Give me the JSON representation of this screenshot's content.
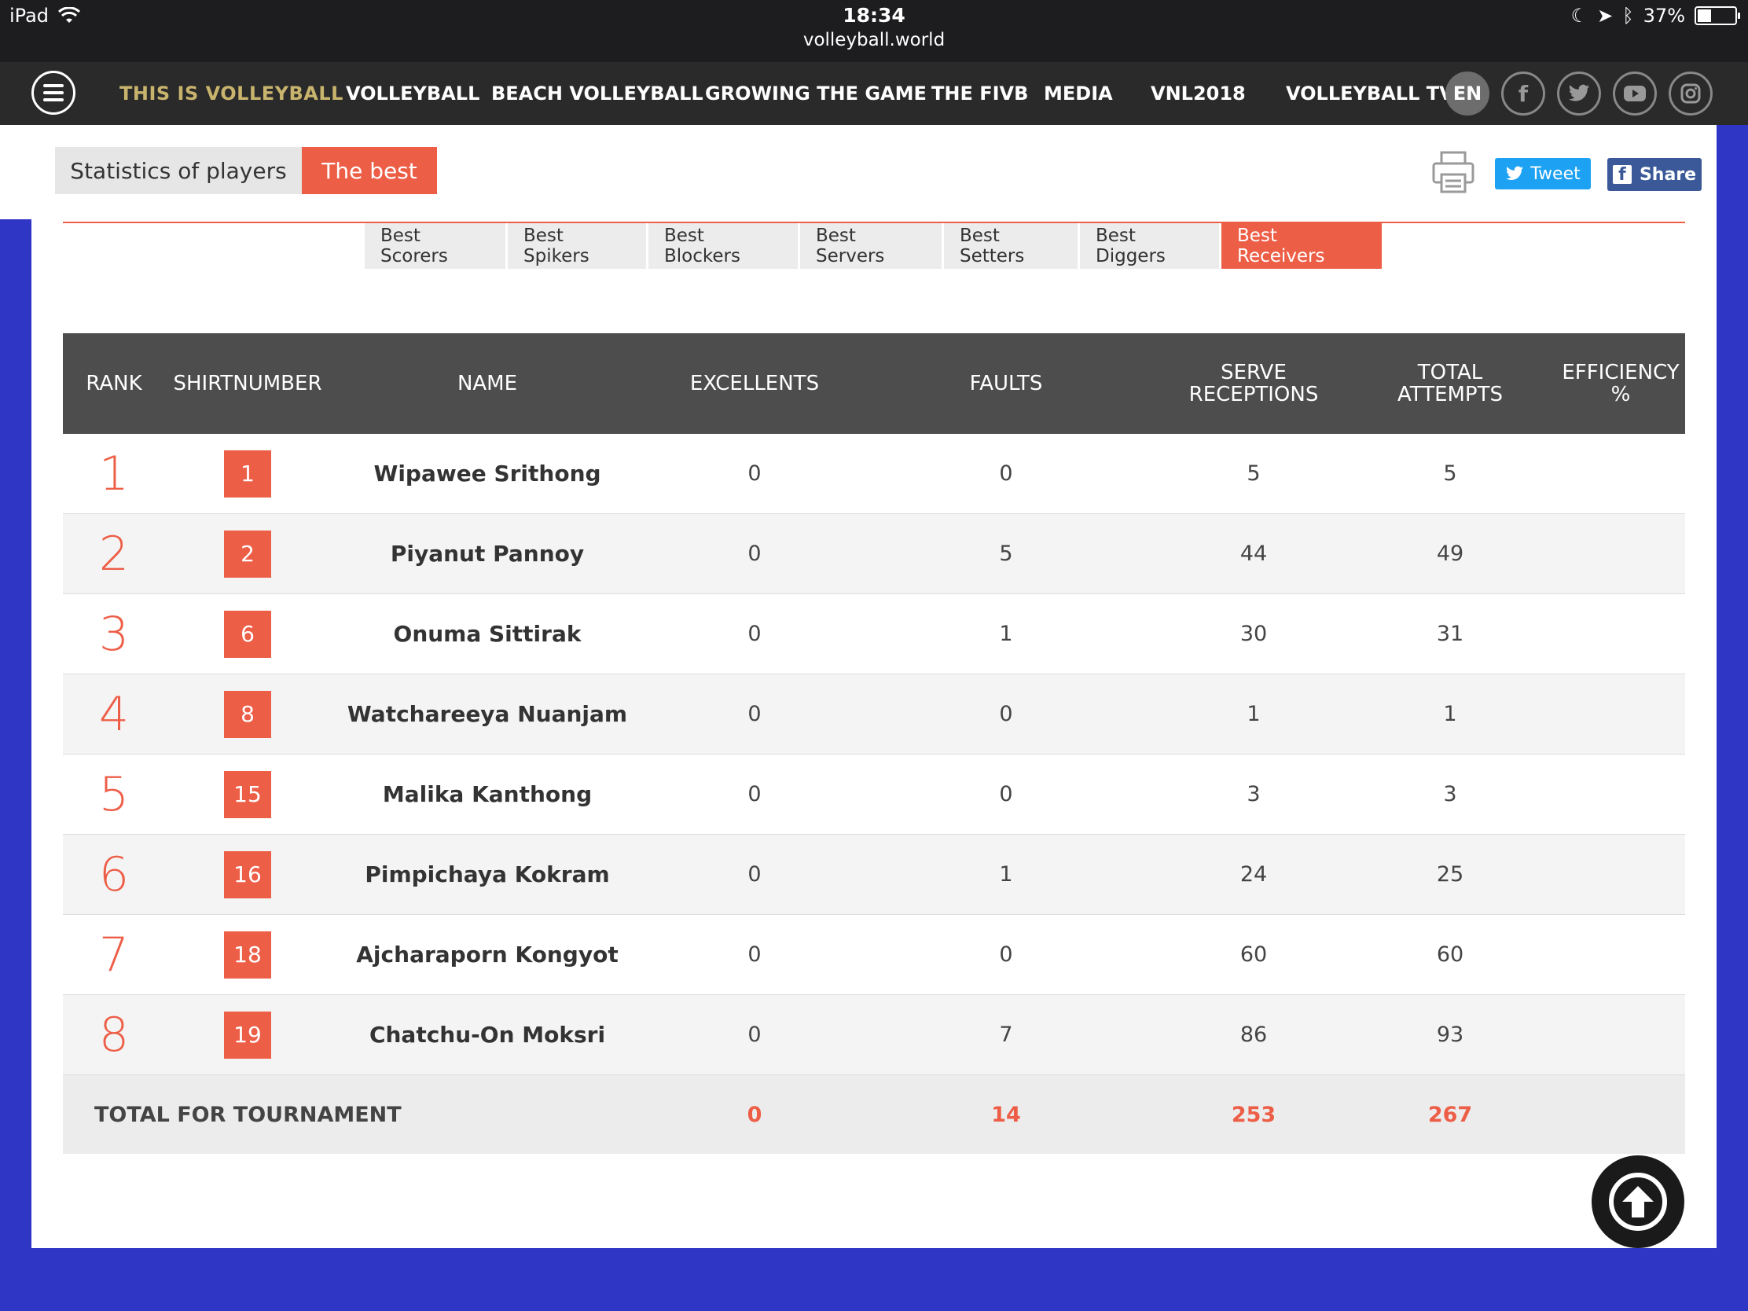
{
  "status": {
    "device": "iPad",
    "time": "18:34",
    "url": "volleyball.world",
    "battery": "37%",
    "battery_level": 0.37
  },
  "nav": {
    "brand": "THIS IS VOLLEYBALL",
    "items": [
      "VOLLEYBALL",
      "BEACH VOLLEYBALL",
      "GROWING THE GAME",
      "THE FIVB",
      "MEDIA",
      "VNL2018",
      "VOLLEYBALL TV"
    ],
    "language": "EN"
  },
  "toolbar": {
    "stats_label": "Statistics of players",
    "best_label": "The best",
    "tweet_label": "Tweet",
    "share_label": "Share"
  },
  "subtabs": [
    "Best Scorers",
    "Best Spikers",
    "Best Blockers",
    "Best Servers",
    "Best Setters",
    "Best Diggers",
    "Best Receivers"
  ],
  "active_subtab": "Best Receivers",
  "table": {
    "headers": {
      "rank": "RANK",
      "shirt": "SHIRTNUMBER",
      "name": "NAME",
      "excellents": "EXCELLENTS",
      "faults": "FAULTS",
      "serve_1": "SERVE",
      "serve_2": "RECEPTIONS",
      "total_1": "TOTAL",
      "total_2": "ATTEMPTS",
      "eff_1": "EFFICIENCY",
      "eff_2": "%"
    },
    "rows": [
      {
        "rank": "1",
        "shirt": "1",
        "name": "Wipawee Srithong",
        "excellents": "0",
        "faults": "0",
        "receptions": "5",
        "attempts": "5",
        "efficiency": ""
      },
      {
        "rank": "2",
        "shirt": "2",
        "name": "Piyanut Pannoy",
        "excellents": "0",
        "faults": "5",
        "receptions": "44",
        "attempts": "49",
        "efficiency": ""
      },
      {
        "rank": "3",
        "shirt": "6",
        "name": "Onuma Sittirak",
        "excellents": "0",
        "faults": "1",
        "receptions": "30",
        "attempts": "31",
        "efficiency": ""
      },
      {
        "rank": "4",
        "shirt": "8",
        "name": "Watchareeya Nuanjam",
        "excellents": "0",
        "faults": "0",
        "receptions": "1",
        "attempts": "1",
        "efficiency": ""
      },
      {
        "rank": "5",
        "shirt": "15",
        "name": "Malika Kanthong",
        "excellents": "0",
        "faults": "0",
        "receptions": "3",
        "attempts": "3",
        "efficiency": ""
      },
      {
        "rank": "6",
        "shirt": "16",
        "name": "Pimpichaya Kokram",
        "excellents": "0",
        "faults": "1",
        "receptions": "24",
        "attempts": "25",
        "efficiency": ""
      },
      {
        "rank": "7",
        "shirt": "18",
        "name": "Ajcharaporn Kongyot",
        "excellents": "0",
        "faults": "0",
        "receptions": "60",
        "attempts": "60",
        "efficiency": ""
      },
      {
        "rank": "8",
        "shirt": "19",
        "name": "Chatchu-On Moksri",
        "excellents": "0",
        "faults": "7",
        "receptions": "86",
        "attempts": "93",
        "efficiency": ""
      }
    ],
    "total": {
      "label": "TOTAL FOR TOURNAMENT",
      "excellents": "0",
      "faults": "14",
      "receptions": "253",
      "attempts": "267"
    }
  },
  "colors": {
    "accent": "#ed5e47",
    "nav_bg": "#2a2a2a",
    "page_bg": "#2f35c4",
    "brand_gold": "#c9b46e"
  }
}
